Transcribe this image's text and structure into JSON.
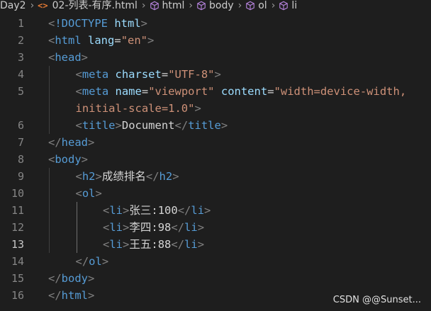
{
  "breadcrumb": {
    "items": [
      {
        "label": "Day2",
        "icon": "none"
      },
      {
        "label": "02-列表-有序.html",
        "icon": "html-file-icon"
      },
      {
        "label": "html",
        "icon": "cube-icon"
      },
      {
        "label": "body",
        "icon": "cube-icon"
      },
      {
        "label": "ol",
        "icon": "cube-icon"
      },
      {
        "label": "li",
        "icon": "cube-icon"
      }
    ],
    "file_icon_glyph": "<>"
  },
  "editor": {
    "active_line": 13,
    "lines": [
      {
        "n": "1",
        "indent": 0,
        "tokens": [
          {
            "t": "punc",
            "v": "<"
          },
          {
            "t": "tag",
            "v": "!DOCTYPE"
          },
          {
            "t": "txt",
            "v": " "
          },
          {
            "t": "attr",
            "v": "html"
          },
          {
            "t": "punc",
            "v": ">"
          }
        ]
      },
      {
        "n": "2",
        "indent": 0,
        "tokens": [
          {
            "t": "punc",
            "v": "<"
          },
          {
            "t": "tag",
            "v": "html"
          },
          {
            "t": "txt",
            "v": " "
          },
          {
            "t": "attr",
            "v": "lang"
          },
          {
            "t": "eq",
            "v": "="
          },
          {
            "t": "val",
            "v": "\"en\""
          },
          {
            "t": "punc",
            "v": ">"
          }
        ]
      },
      {
        "n": "3",
        "indent": 0,
        "tokens": [
          {
            "t": "punc",
            "v": "<"
          },
          {
            "t": "tag",
            "v": "head"
          },
          {
            "t": "punc",
            "v": ">"
          }
        ]
      },
      {
        "n": "4",
        "indent": 1,
        "tokens": [
          {
            "t": "punc",
            "v": "<"
          },
          {
            "t": "tag",
            "v": "meta"
          },
          {
            "t": "txt",
            "v": " "
          },
          {
            "t": "attr",
            "v": "charset"
          },
          {
            "t": "eq",
            "v": "="
          },
          {
            "t": "val",
            "v": "\"UTF-8\""
          },
          {
            "t": "punc",
            "v": ">"
          }
        ]
      },
      {
        "n": "5",
        "indent": 1,
        "tokens": [
          {
            "t": "punc",
            "v": "<"
          },
          {
            "t": "tag",
            "v": "meta"
          },
          {
            "t": "txt",
            "v": " "
          },
          {
            "t": "attr",
            "v": "name"
          },
          {
            "t": "eq",
            "v": "="
          },
          {
            "t": "val",
            "v": "\"viewport\""
          },
          {
            "t": "txt",
            "v": " "
          },
          {
            "t": "attr",
            "v": "content"
          },
          {
            "t": "eq",
            "v": "="
          },
          {
            "t": "val",
            "v": "\"width=device-width,"
          }
        ]
      },
      {
        "n": "",
        "indent": 1,
        "tokens": [
          {
            "t": "val",
            "v": "initial-scale=1.0\""
          },
          {
            "t": "punc",
            "v": ">"
          }
        ]
      },
      {
        "n": "6",
        "indent": 1,
        "tokens": [
          {
            "t": "punc",
            "v": "<"
          },
          {
            "t": "tag",
            "v": "title"
          },
          {
            "t": "punc",
            "v": ">"
          },
          {
            "t": "txt",
            "v": "Document"
          },
          {
            "t": "punc",
            "v": "</"
          },
          {
            "t": "tag",
            "v": "title"
          },
          {
            "t": "punc",
            "v": ">"
          }
        ]
      },
      {
        "n": "7",
        "indent": 0,
        "tokens": [
          {
            "t": "punc",
            "v": "</"
          },
          {
            "t": "tag",
            "v": "head"
          },
          {
            "t": "punc",
            "v": ">"
          }
        ]
      },
      {
        "n": "8",
        "indent": 0,
        "tokens": [
          {
            "t": "punc",
            "v": "<"
          },
          {
            "t": "tag",
            "v": "body"
          },
          {
            "t": "punc",
            "v": ">"
          }
        ]
      },
      {
        "n": "9",
        "indent": 1,
        "tokens": [
          {
            "t": "punc",
            "v": "<"
          },
          {
            "t": "tag",
            "v": "h2"
          },
          {
            "t": "punc",
            "v": ">"
          },
          {
            "t": "txt",
            "v": "成绩排名"
          },
          {
            "t": "punc",
            "v": "</"
          },
          {
            "t": "tag",
            "v": "h2"
          },
          {
            "t": "punc",
            "v": ">"
          }
        ]
      },
      {
        "n": "10",
        "indent": 1,
        "tokens": [
          {
            "t": "punc",
            "v": "<"
          },
          {
            "t": "tag",
            "v": "ol"
          },
          {
            "t": "punc",
            "v": ">"
          }
        ]
      },
      {
        "n": "11",
        "indent": 2,
        "tokens": [
          {
            "t": "punc",
            "v": "<"
          },
          {
            "t": "tag",
            "v": "li"
          },
          {
            "t": "punc",
            "v": ">"
          },
          {
            "t": "txt",
            "v": "张三:100"
          },
          {
            "t": "punc",
            "v": "</"
          },
          {
            "t": "tag",
            "v": "li"
          },
          {
            "t": "punc",
            "v": ">"
          }
        ]
      },
      {
        "n": "12",
        "indent": 2,
        "tokens": [
          {
            "t": "punc",
            "v": "<"
          },
          {
            "t": "tag",
            "v": "li"
          },
          {
            "t": "punc",
            "v": ">"
          },
          {
            "t": "txt",
            "v": "李四:98"
          },
          {
            "t": "punc",
            "v": "</"
          },
          {
            "t": "tag",
            "v": "li"
          },
          {
            "t": "punc",
            "v": ">"
          }
        ]
      },
      {
        "n": "13",
        "indent": 2,
        "tokens": [
          {
            "t": "punc",
            "v": "<"
          },
          {
            "t": "tag",
            "v": "li"
          },
          {
            "t": "punc",
            "v": ">"
          },
          {
            "t": "txt",
            "v": "王五:88"
          },
          {
            "t": "punc",
            "v": "</"
          },
          {
            "t": "tag",
            "v": "li"
          },
          {
            "t": "punc",
            "v": ">"
          }
        ]
      },
      {
        "n": "14",
        "indent": 1,
        "tokens": [
          {
            "t": "punc",
            "v": "</"
          },
          {
            "t": "tag",
            "v": "ol"
          },
          {
            "t": "punc",
            "v": ">"
          }
        ]
      },
      {
        "n": "15",
        "indent": 0,
        "tokens": [
          {
            "t": "punc",
            "v": "</"
          },
          {
            "t": "tag",
            "v": "body"
          },
          {
            "t": "punc",
            "v": ">"
          }
        ]
      },
      {
        "n": "16",
        "indent": 0,
        "tokens": [
          {
            "t": "punc",
            "v": "</"
          },
          {
            "t": "tag",
            "v": "html"
          },
          {
            "t": "punc",
            "v": ">"
          }
        ]
      }
    ]
  },
  "watermark": "CSDN @@Sunset...",
  "colors": {
    "background": "#1e1e1e",
    "tag": "#569cd6",
    "attribute": "#9cdcfe",
    "string": "#ce9178",
    "punctuation": "#808080",
    "text": "#d4d4d4",
    "line_number": "#858585",
    "file_icon": "#e37933"
  }
}
